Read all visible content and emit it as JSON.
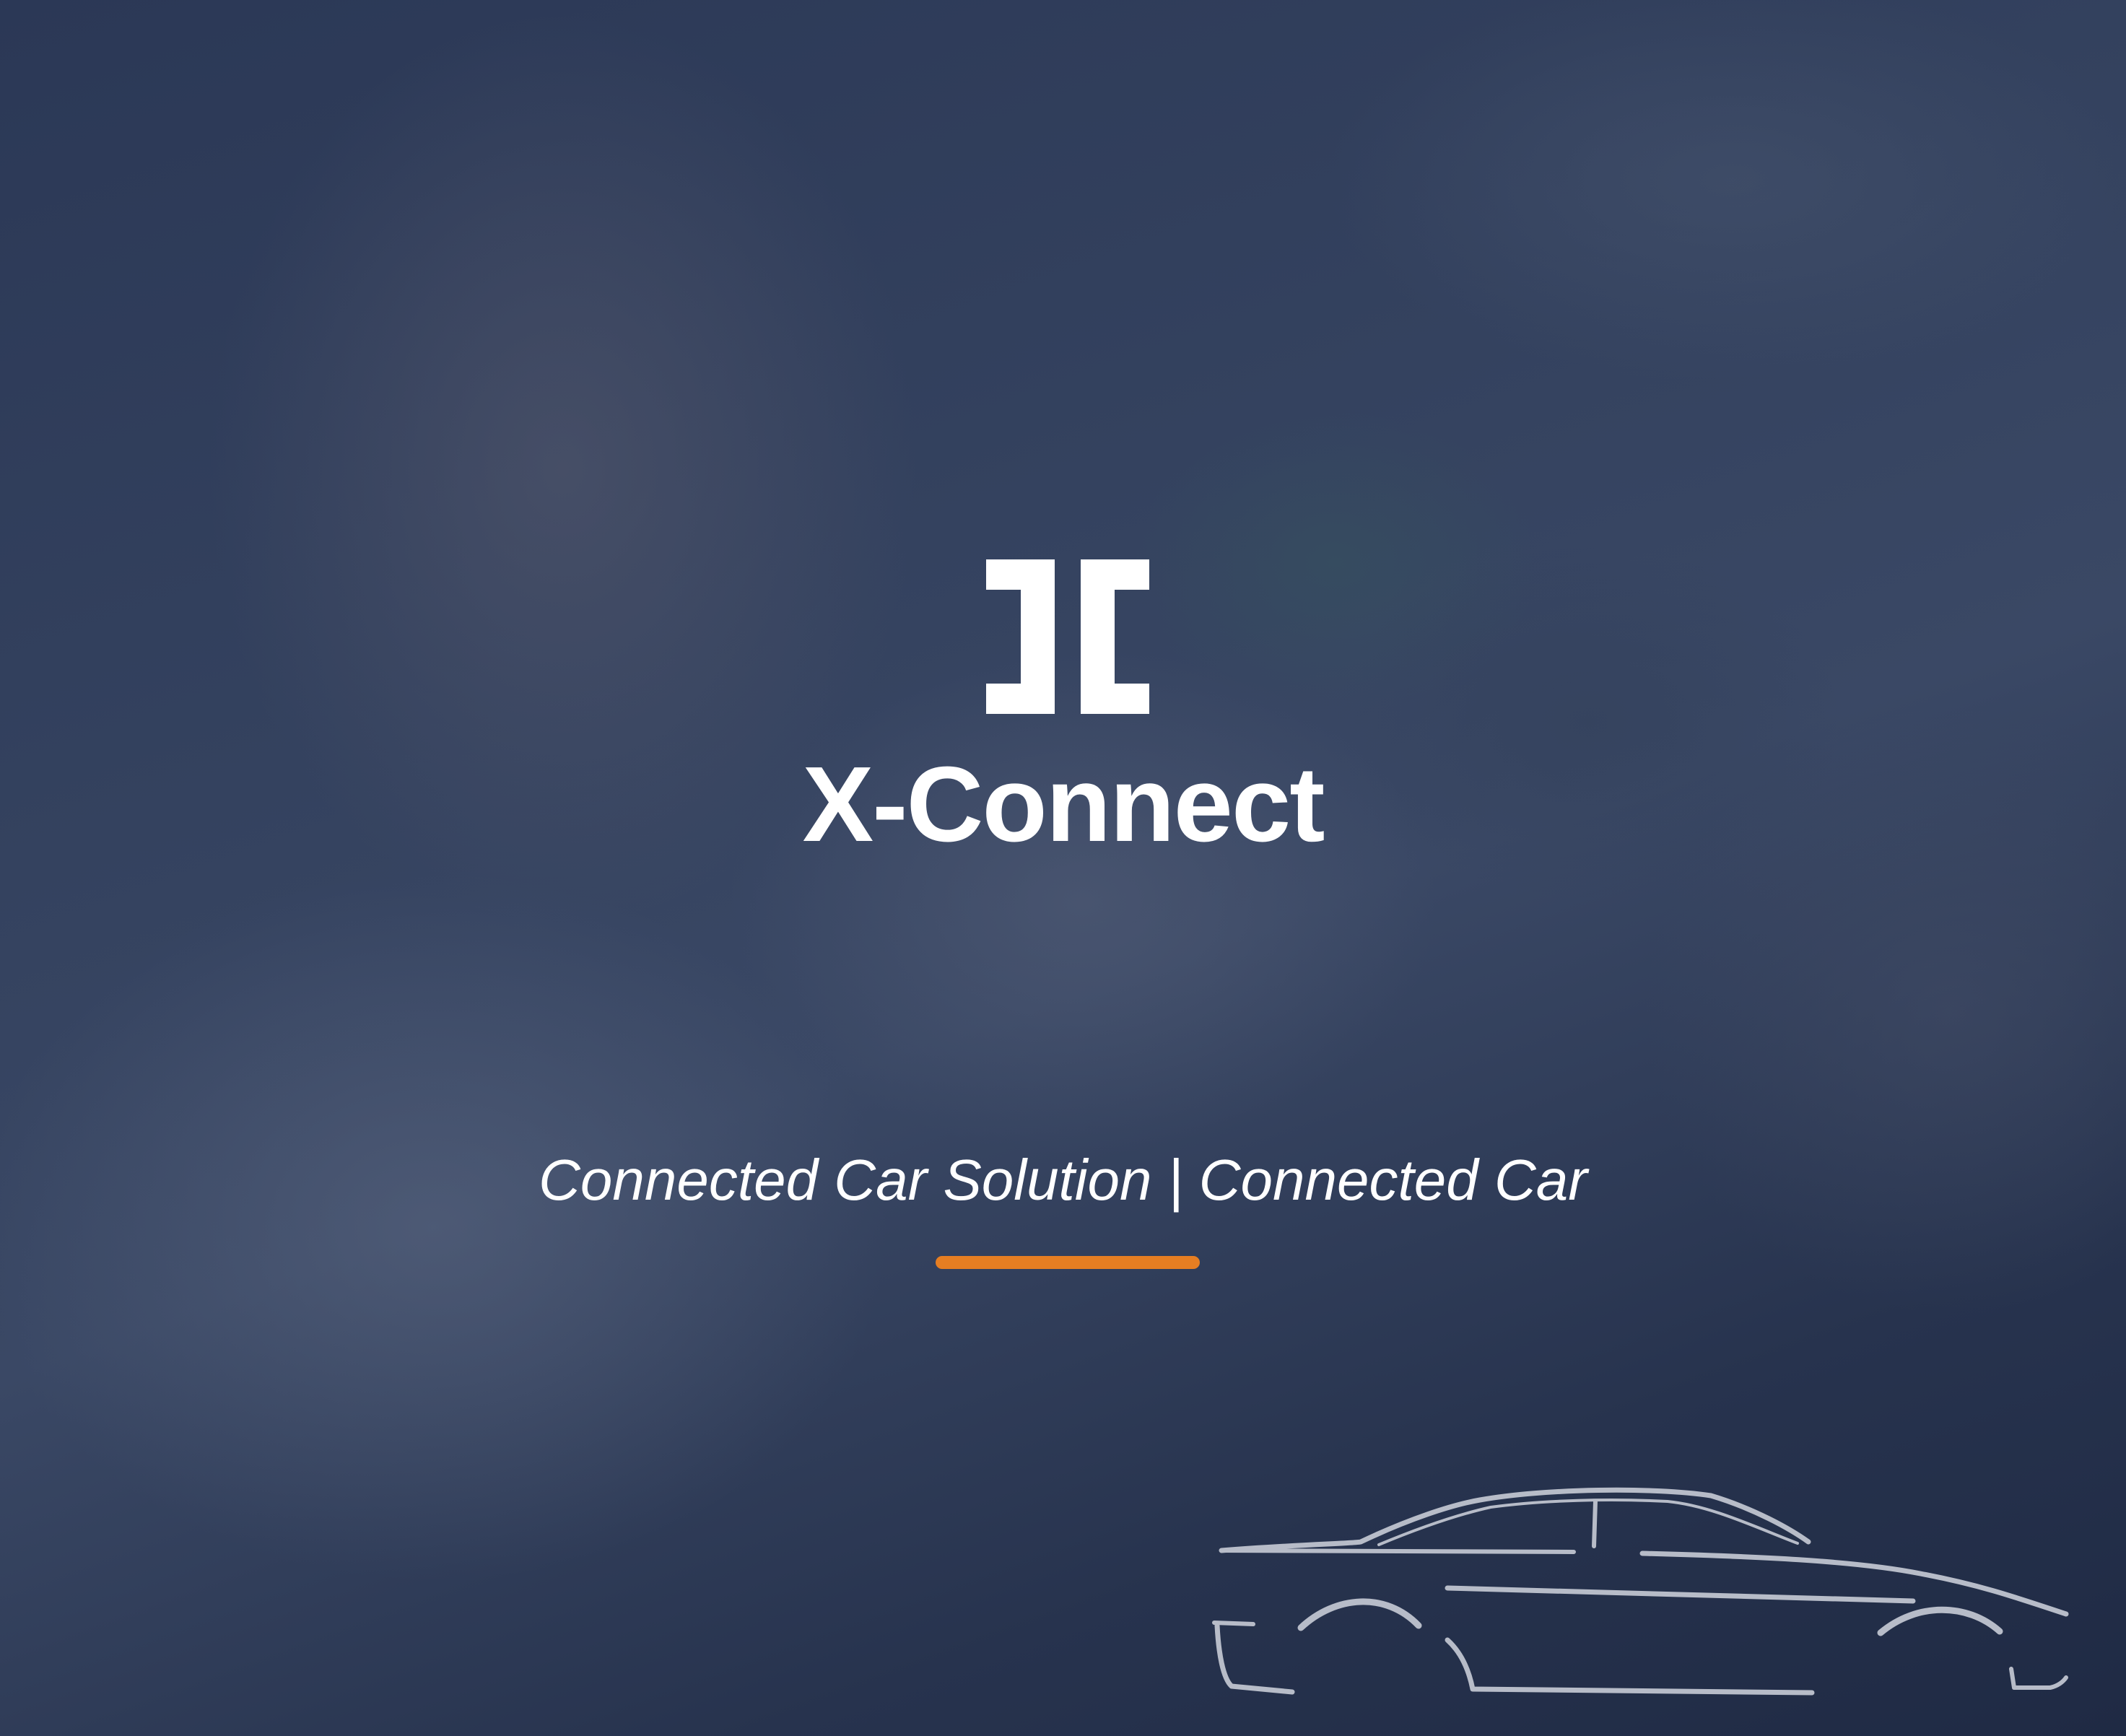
{
  "brand": {
    "logo_icon": "bracket-logo-icon",
    "name": "X-Connect"
  },
  "tagline": {
    "text": "Connected Car Solution | Connected Car"
  },
  "decor": {
    "car_icon": "car-silhouette-icon"
  },
  "colors": {
    "background": "#243049",
    "text": "#ffffff",
    "accent": "#e67e22",
    "car_outline": "#b7bcc8"
  }
}
